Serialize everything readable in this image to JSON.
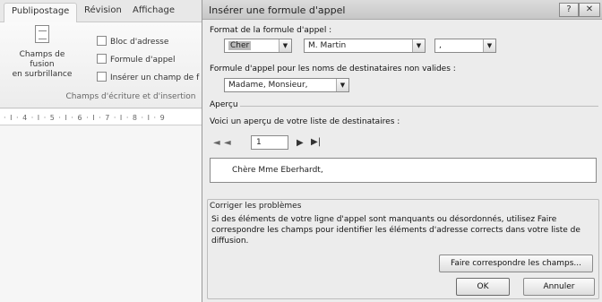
{
  "ribbon": {
    "tabs": [
      "Publipostage",
      "Révision",
      "Affichage"
    ],
    "big_button_label_1": "Champs de fusion",
    "big_button_label_2": "en surbrillance",
    "small_buttons": [
      "Bloc d'adresse",
      "Formule d'appel",
      "Insérer un champ de f"
    ],
    "group_label": "Champs d'écriture et d'insertion",
    "ruler_text": "· I · 4 · I · 5 · I · 6 · I · 7 · I · 8 · I · 9"
  },
  "dialog": {
    "title": "Insérer une formule d'appel",
    "help_icon": "help-icon",
    "close_icon": "close-icon",
    "format_label": "Format de la formule d'appel :",
    "salutation_value": "Cher",
    "name_format_value": "M. Martin",
    "punctuation_value": ",",
    "invalid_label": "Formule d'appel pour les noms de destinataires non valides :",
    "invalid_value": "Madame, Monsieur,",
    "preview_section": "Aperçu",
    "preview_label": "Voici un aperçu de votre liste de destinataires :",
    "recipient_index": "1",
    "preview_text": "Chère Mme Eberhardt,",
    "fix_section": "Corriger les problèmes",
    "fix_text": "Si des éléments de votre ligne d'appel sont manquants ou désordonnés, utilisez Faire correspondre les champs pour identifier les éléments d'adresse corrects dans votre liste de diffusion.",
    "match_button": "Faire correspondre les champs...",
    "ok_button": "OK",
    "cancel_button": "Annuler"
  }
}
